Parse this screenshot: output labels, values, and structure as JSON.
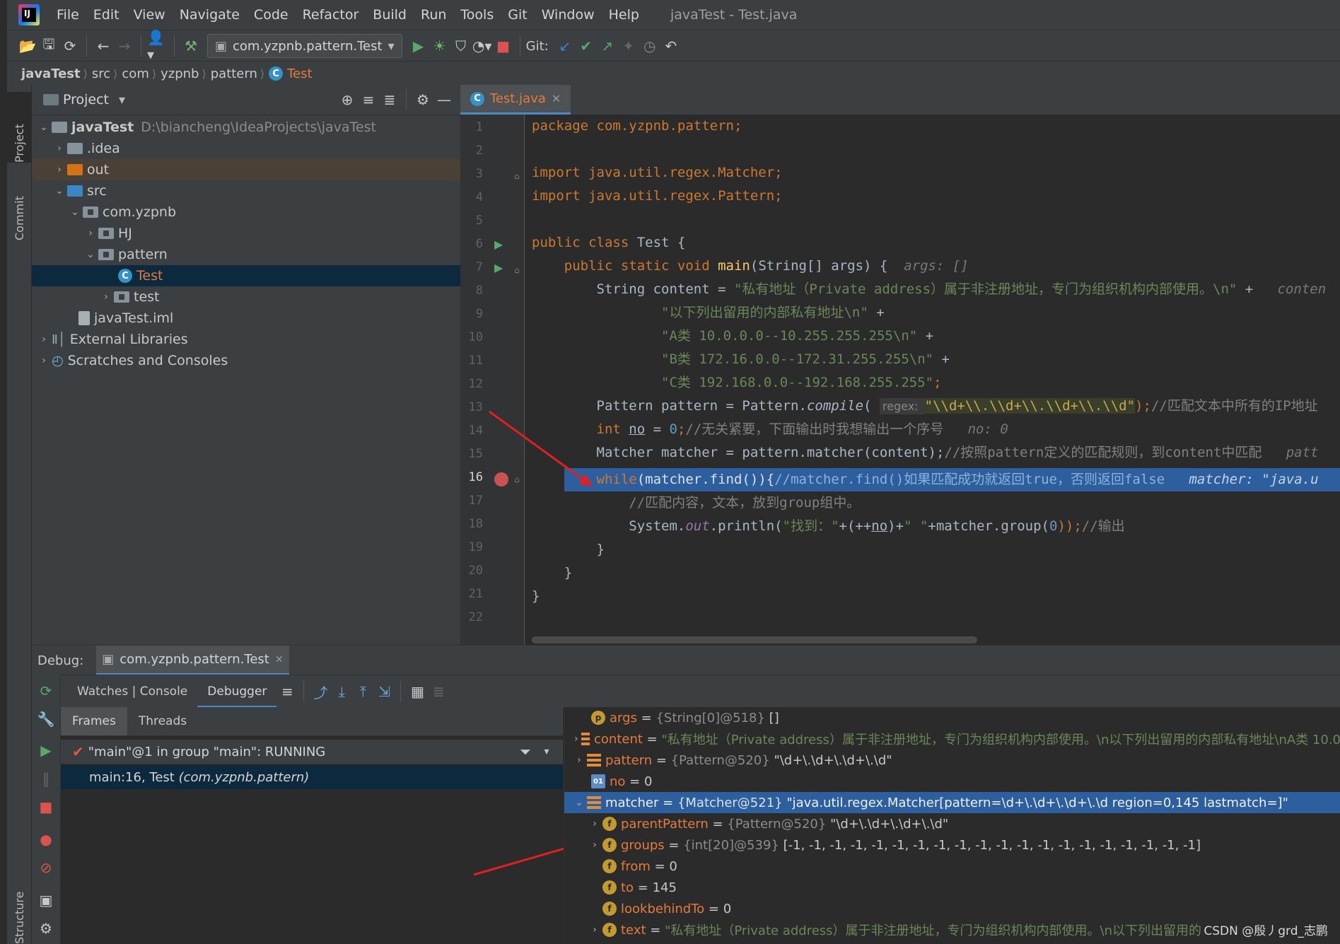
{
  "menu": [
    "File",
    "Edit",
    "View",
    "Navigate",
    "Code",
    "Refactor",
    "Build",
    "Run",
    "Tools",
    "Git",
    "Window",
    "Help"
  ],
  "window_title": "javaTest - Test.java",
  "toolbar": {
    "run_config": "com.yzpnb.pattern.Test",
    "git_label": "Git:"
  },
  "breadcrumb": [
    "javaTest",
    "src",
    "com",
    "yzpnb",
    "pattern",
    "Test"
  ],
  "left_strip": {
    "project": "Project",
    "commit": "Commit",
    "structure": "Structure"
  },
  "project_panel": {
    "title": "Project",
    "tree": [
      {
        "label": "javaTest",
        "path": "D:\\biancheng\\IdeaProjects\\javaTest"
      },
      {
        "label": ".idea"
      },
      {
        "label": "out"
      },
      {
        "label": "src"
      },
      {
        "label": "com.yzpnb"
      },
      {
        "label": "HJ"
      },
      {
        "label": "pattern"
      },
      {
        "label": "Test"
      },
      {
        "label": "test"
      },
      {
        "label": "javaTest.iml"
      },
      {
        "label": "External Libraries"
      },
      {
        "label": "Scratches and Consoles"
      }
    ]
  },
  "editor": {
    "tab": "Test.java",
    "line_numbers": [
      "1",
      "2",
      "3",
      "4",
      "5",
      "6",
      "7",
      "8",
      "9",
      "10",
      "11",
      "12",
      "13",
      "14",
      "15",
      "16",
      "17",
      "18",
      "19",
      "20",
      "21",
      "22"
    ],
    "code": {
      "l1": "package com.yzpnb.pattern;",
      "l3": "import java.util.regex.Matcher;",
      "l4": "import java.util.regex.Pattern;",
      "l6a": "public class ",
      "l6b": "Test {",
      "l7a": "    public static void ",
      "l7b": "main",
      "l7c": "(String[] args) {  ",
      "l7d": "args: []",
      "l8a": "        String content = ",
      "l8b": "\"私有地址（Private address）属于非注册地址，专门为组织机构内部使用。\\n\"",
      "l8c": " +   ",
      "l8d": "conten",
      "l9": "                \"以下列出留用的内部私有地址\\n\"",
      "l9b": " +",
      "l10": "                \"A类 10.0.0.0--10.255.255.255\\n\"",
      "l10b": " +",
      "l11": "                \"B类 172.16.0.0--172.31.255.255\\n\"",
      "l11b": " +",
      "l12": "                \"C类 192.168.0.0--192.168.255.255\"",
      "l12b": ";",
      "l13a": "        Pattern pattern = Pattern.",
      "l13b": "compile",
      "l13c": "( ",
      "l13d": "regex: ",
      "l13e": "\"\\\\d+\\\\.\\\\d+\\\\.\\\\d+\\\\.\\\\d\"",
      "l13f": ");",
      "l13g": "//匹配文本中所有的IP地址",
      "l14a": "        ",
      "l14b": "int ",
      "l14c": "no",
      "l14d": " = ",
      "l14e": "0",
      "l14f": ";",
      "l14g": "//无关紧要，下面输出时我想输出一个序号   ",
      "l14h": "no: 0",
      "l15a": "        Matcher matcher = pattern.matcher(content);",
      "l15b": "//按照pattern定义的匹配规则，到content中匹配   ",
      "l15c": "patt",
      "l16a": "        while",
      "l16b": "(matcher.find()){",
      "l16c": "//matcher.find()如果匹配成功就返回true，否则返回false   ",
      "l16d": "matcher: \"java.u",
      "l17": "            //匹配内容，文本，放到group组中。",
      "l18a": "            System.",
      "l18b": "out",
      "l18c": ".println(",
      "l18d": "\"找到：\"",
      "l18e": "+(++",
      "l18f": "no",
      "l18g": ")+",
      "l18h": "\" \"",
      "l18i": "+matcher.group(",
      "l18j": "0",
      "l18k": "));",
      "l18l": "//输出",
      "l19": "        }",
      "l20": "    }",
      "l21": "}"
    }
  },
  "debug": {
    "label": "Debug:",
    "session_tab": "com.yzpnb.pattern.Test",
    "tabs": [
      "Watches | Console",
      "Debugger"
    ],
    "frame_tabs": [
      "Frames",
      "Threads"
    ],
    "thread": "\"main\"@1 in group \"main\": RUNNING",
    "frame_main": "main:16, Test ",
    "frame_pkg": "(com.yzpnb.pattern)",
    "vars": [
      {
        "name": "args",
        "type": "{String[0]@518}",
        "value": "[]"
      },
      {
        "name": "content",
        "value": "\"私有地址（Private address）属于非注册地址，专门为组织机构内部使用。\\n以下列出留用的内部私有地址\\nA类 10.0"
      },
      {
        "name": "pattern",
        "type": "{Pattern@520}",
        "value": "\"\\d+\\.\\d+\\.\\d+\\.\\d\""
      },
      {
        "name": "no",
        "value": "0"
      },
      {
        "name": "matcher",
        "type": "{Matcher@521}",
        "value": "\"java.util.regex.Matcher[pattern=\\d+\\.\\d+\\.\\d+\\.\\d region=0,145 lastmatch=]\""
      },
      {
        "name": "parentPattern",
        "type": "{Pattern@520}",
        "value": "\"\\d+\\.\\d+\\.\\d+\\.\\d\""
      },
      {
        "name": "groups",
        "type": "{int[20]@539}",
        "value": "[-1, -1, -1, -1, -1, -1, -1, -1, -1, -1, -1, -1, -1, -1, -1, -1, -1, -1, -1, -1]"
      },
      {
        "name": "from",
        "value": "0"
      },
      {
        "name": "to",
        "value": "145"
      },
      {
        "name": "lookbehindTo",
        "value": "0"
      },
      {
        "name": "text",
        "value": "\"私有地址（Private address）属于非注册地址，专门为组织机构内部使用。\\n以下列出留用的"
      }
    ]
  },
  "watermark": "CSDN @殷丿grd_志鹏",
  "colors": {
    "accent": "#4a88c7",
    "selection": "#2d5f9e",
    "keyword": "#cc7832",
    "string": "#6a8759"
  }
}
